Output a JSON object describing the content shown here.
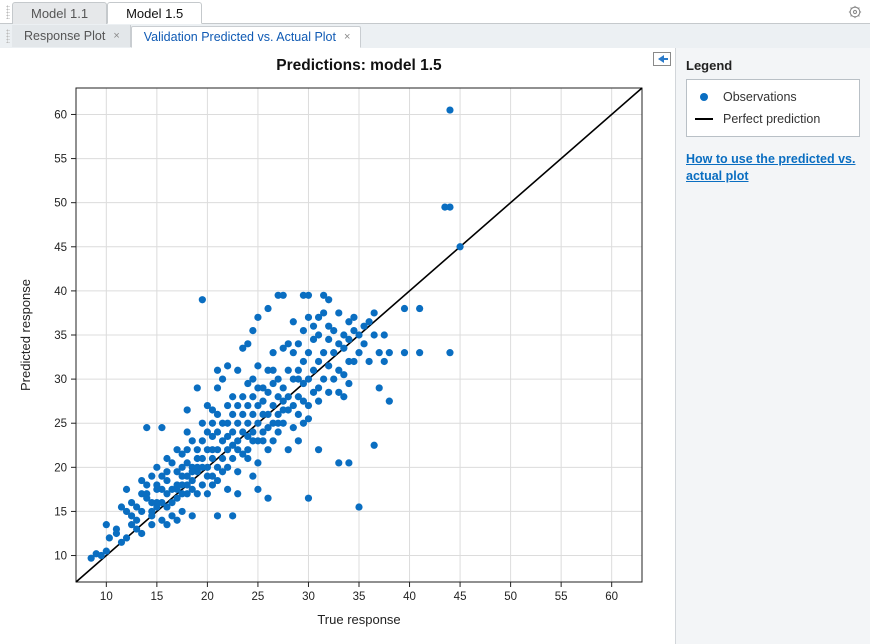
{
  "model_tabs": [
    {
      "label": "Model 1.1",
      "active": false
    },
    {
      "label": "Model 1.5",
      "active": true
    }
  ],
  "plot_tabs": [
    {
      "label": "Response Plot",
      "active": false
    },
    {
      "label": "Validation Predicted vs. Actual Plot",
      "active": true
    }
  ],
  "legend": {
    "title": "Legend",
    "items": [
      {
        "kind": "dot",
        "label": "Observations"
      },
      {
        "kind": "line",
        "label": "Perfect prediction"
      }
    ]
  },
  "help_link": "How to use the predicted vs. actual plot",
  "chart_data": {
    "type": "scatter",
    "title": "Predictions: model 1.5",
    "xlabel": "True response",
    "ylabel": "Predicted response",
    "xlim": [
      7,
      63
    ],
    "ylim": [
      7,
      63
    ],
    "xticks": [
      10,
      15,
      20,
      25,
      30,
      35,
      40,
      45,
      50,
      55,
      60
    ],
    "yticks": [
      10,
      15,
      20,
      25,
      30,
      35,
      40,
      45,
      50,
      55,
      60
    ],
    "perfect_line": {
      "x0": 7,
      "y0": 7,
      "x1": 63,
      "y1": 63
    },
    "series": [
      {
        "name": "Observations",
        "points": [
          [
            8.5,
            9.7
          ],
          [
            9.0,
            10.2
          ],
          [
            9.5,
            10.0
          ],
          [
            10.0,
            10.5
          ],
          [
            10.0,
            13.5
          ],
          [
            10.3,
            12.0
          ],
          [
            11.0,
            12.5
          ],
          [
            11.0,
            13.0
          ],
          [
            11.5,
            11.5
          ],
          [
            11.5,
            15.5
          ],
          [
            12.0,
            15.0
          ],
          [
            12.0,
            12.0
          ],
          [
            12.0,
            17.5
          ],
          [
            12.5,
            13.5
          ],
          [
            12.5,
            14.5
          ],
          [
            12.5,
            16.0
          ],
          [
            13.0,
            14.0
          ],
          [
            13.0,
            13.0
          ],
          [
            13.0,
            15.5
          ],
          [
            13.5,
            12.5
          ],
          [
            13.5,
            17.0
          ],
          [
            13.5,
            18.5
          ],
          [
            13.5,
            15.0
          ],
          [
            14.0,
            24.5
          ],
          [
            14.0,
            17.0
          ],
          [
            14.0,
            18.0
          ],
          [
            14.0,
            16.5
          ],
          [
            14.5,
            14.5
          ],
          [
            14.5,
            16.0
          ],
          [
            14.5,
            15.0
          ],
          [
            14.5,
            19.0
          ],
          [
            14.5,
            13.5
          ],
          [
            15.0,
            16.0
          ],
          [
            15.0,
            17.5
          ],
          [
            15.0,
            20.0
          ],
          [
            15.0,
            15.5
          ],
          [
            15.0,
            18.0
          ],
          [
            15.5,
            24.5
          ],
          [
            15.5,
            14.0
          ],
          [
            15.5,
            16.0
          ],
          [
            15.5,
            19.0
          ],
          [
            15.5,
            17.5
          ],
          [
            16.0,
            17.0
          ],
          [
            16.0,
            18.5
          ],
          [
            16.0,
            15.5
          ],
          [
            16.0,
            21.0
          ],
          [
            16.0,
            19.5
          ],
          [
            16.0,
            13.5
          ],
          [
            16.5,
            17.5
          ],
          [
            16.5,
            16.0
          ],
          [
            16.5,
            20.5
          ],
          [
            16.5,
            14.5
          ],
          [
            17.0,
            16.5
          ],
          [
            17.0,
            18.0
          ],
          [
            17.0,
            22.0
          ],
          [
            17.0,
            19.5
          ],
          [
            17.0,
            17.5
          ],
          [
            17.0,
            14.0
          ],
          [
            17.5,
            19.0
          ],
          [
            17.5,
            18.0
          ],
          [
            17.5,
            17.0
          ],
          [
            17.5,
            20.0
          ],
          [
            17.5,
            21.5
          ],
          [
            17.5,
            15.0
          ],
          [
            18.0,
            18.0
          ],
          [
            18.0,
            20.5
          ],
          [
            18.0,
            19.0
          ],
          [
            18.0,
            22.0
          ],
          [
            18.0,
            24.0
          ],
          [
            18.0,
            17.0
          ],
          [
            18.0,
            26.5
          ],
          [
            18.5,
            18.5
          ],
          [
            18.5,
            20.0
          ],
          [
            18.5,
            23.0
          ],
          [
            18.5,
            17.5
          ],
          [
            18.5,
            19.5
          ],
          [
            18.5,
            14.5
          ],
          [
            19.0,
            22.0
          ],
          [
            19.0,
            21.0
          ],
          [
            19.0,
            19.5
          ],
          [
            19.0,
            29.0
          ],
          [
            19.0,
            20.0
          ],
          [
            19.0,
            17.0
          ],
          [
            19.5,
            39.0
          ],
          [
            19.5,
            18.0
          ],
          [
            19.5,
            21.0
          ],
          [
            19.5,
            25.0
          ],
          [
            19.5,
            23.0
          ],
          [
            19.5,
            20.0
          ],
          [
            20.0,
            19.0
          ],
          [
            20.0,
            22.0
          ],
          [
            20.0,
            24.0
          ],
          [
            20.0,
            20.0
          ],
          [
            20.0,
            17.0
          ],
          [
            20.0,
            27.0
          ],
          [
            20.5,
            21.0
          ],
          [
            20.5,
            23.5
          ],
          [
            20.5,
            22.0
          ],
          [
            20.5,
            25.0
          ],
          [
            20.5,
            19.0
          ],
          [
            20.5,
            18.0
          ],
          [
            20.5,
            26.5
          ],
          [
            21.0,
            26.0
          ],
          [
            21.0,
            22.0
          ],
          [
            21.0,
            24.0
          ],
          [
            21.0,
            20.0
          ],
          [
            21.0,
            31.0
          ],
          [
            21.0,
            18.5
          ],
          [
            21.0,
            29.0
          ],
          [
            21.0,
            14.5
          ],
          [
            21.5,
            23.0
          ],
          [
            21.5,
            25.0
          ],
          [
            21.5,
            21.0
          ],
          [
            21.5,
            19.5
          ],
          [
            21.5,
            30.0
          ],
          [
            22.0,
            23.5
          ],
          [
            22.0,
            22.0
          ],
          [
            22.0,
            27.0
          ],
          [
            22.0,
            25.0
          ],
          [
            22.0,
            31.5
          ],
          [
            22.0,
            20.0
          ],
          [
            22.0,
            17.5
          ],
          [
            22.5,
            21.0
          ],
          [
            22.5,
            24.0
          ],
          [
            22.5,
            26.0
          ],
          [
            22.5,
            28.0
          ],
          [
            22.5,
            22.5
          ],
          [
            22.5,
            14.5
          ],
          [
            23.0,
            25.0
          ],
          [
            23.0,
            27.0
          ],
          [
            23.0,
            23.0
          ],
          [
            23.0,
            31.0
          ],
          [
            23.0,
            19.5
          ],
          [
            23.0,
            17.0
          ],
          [
            23.0,
            22.0
          ],
          [
            23.5,
            24.0
          ],
          [
            23.5,
            26.0
          ],
          [
            23.5,
            28.0
          ],
          [
            23.5,
            33.5
          ],
          [
            23.5,
            21.5
          ],
          [
            24.0,
            25.0
          ],
          [
            24.0,
            27.0
          ],
          [
            24.0,
            29.5
          ],
          [
            24.0,
            23.5
          ],
          [
            24.0,
            34.0
          ],
          [
            24.0,
            21.0
          ],
          [
            24.0,
            22.0
          ],
          [
            24.5,
            26.0
          ],
          [
            24.5,
            28.0
          ],
          [
            24.5,
            30.0
          ],
          [
            24.5,
            24.0
          ],
          [
            24.5,
            23.0
          ],
          [
            24.5,
            35.5
          ],
          [
            24.5,
            19.0
          ],
          [
            25.0,
            25.0
          ],
          [
            25.0,
            27.0
          ],
          [
            25.0,
            29.0
          ],
          [
            25.0,
            37.0
          ],
          [
            25.0,
            23.0
          ],
          [
            25.0,
            20.5
          ],
          [
            25.0,
            17.5
          ],
          [
            25.0,
            31.5
          ],
          [
            25.5,
            26.0
          ],
          [
            25.5,
            27.5
          ],
          [
            25.5,
            24.0
          ],
          [
            25.5,
            29.0
          ],
          [
            25.5,
            23.0
          ],
          [
            26.0,
            28.5
          ],
          [
            26.0,
            26.0
          ],
          [
            26.0,
            31.0
          ],
          [
            26.0,
            24.5
          ],
          [
            26.0,
            22.0
          ],
          [
            26.0,
            16.5
          ],
          [
            26.0,
            38.0
          ],
          [
            26.5,
            27.0
          ],
          [
            26.5,
            29.5
          ],
          [
            26.5,
            25.0
          ],
          [
            26.5,
            31.0
          ],
          [
            26.5,
            33.0
          ],
          [
            26.5,
            23.0
          ],
          [
            27.0,
            28.0
          ],
          [
            27.0,
            30.0
          ],
          [
            27.0,
            26.0
          ],
          [
            27.0,
            39.5
          ],
          [
            27.0,
            25.0
          ],
          [
            27.0,
            24.0
          ],
          [
            27.5,
            27.5
          ],
          [
            27.5,
            29.0
          ],
          [
            27.5,
            33.5
          ],
          [
            27.5,
            26.5
          ],
          [
            27.5,
            25.0
          ],
          [
            27.5,
            39.5
          ],
          [
            28.0,
            28.0
          ],
          [
            28.0,
            31.0
          ],
          [
            28.0,
            26.5
          ],
          [
            28.0,
            34.0
          ],
          [
            28.0,
            22.0
          ],
          [
            28.5,
            30.0
          ],
          [
            28.5,
            33.0
          ],
          [
            28.5,
            27.0
          ],
          [
            28.5,
            24.5
          ],
          [
            28.5,
            36.5
          ],
          [
            29.0,
            31.0
          ],
          [
            29.0,
            28.0
          ],
          [
            29.0,
            34.0
          ],
          [
            29.0,
            26.0
          ],
          [
            29.0,
            30.0
          ],
          [
            29.0,
            23.0
          ],
          [
            29.5,
            29.5
          ],
          [
            29.5,
            32.0
          ],
          [
            29.5,
            35.5
          ],
          [
            29.5,
            27.5
          ],
          [
            29.5,
            25.0
          ],
          [
            29.5,
            39.5
          ],
          [
            30.0,
            30.0
          ],
          [
            30.0,
            33.0
          ],
          [
            30.0,
            37.0
          ],
          [
            30.0,
            27.0
          ],
          [
            30.0,
            39.5
          ],
          [
            30.0,
            25.5
          ],
          [
            30.0,
            16.5
          ],
          [
            30.5,
            31.0
          ],
          [
            30.5,
            28.5
          ],
          [
            30.5,
            34.5
          ],
          [
            30.5,
            36.0
          ],
          [
            31.0,
            32.0
          ],
          [
            31.0,
            29.0
          ],
          [
            31.0,
            35.0
          ],
          [
            31.0,
            37.0
          ],
          [
            31.0,
            22.0
          ],
          [
            31.0,
            27.5
          ],
          [
            31.5,
            33.0
          ],
          [
            31.5,
            30.0
          ],
          [
            31.5,
            37.5
          ],
          [
            31.5,
            39.5
          ],
          [
            32.0,
            34.5
          ],
          [
            32.0,
            31.5
          ],
          [
            32.0,
            28.5
          ],
          [
            32.0,
            36.0
          ],
          [
            32.0,
            39.0
          ],
          [
            32.5,
            33.0
          ],
          [
            32.5,
            35.5
          ],
          [
            32.5,
            30.0
          ],
          [
            33.0,
            34.0
          ],
          [
            33.0,
            31.0
          ],
          [
            33.0,
            37.5
          ],
          [
            33.0,
            28.5
          ],
          [
            33.0,
            20.5
          ],
          [
            33.5,
            33.5
          ],
          [
            33.5,
            35.0
          ],
          [
            33.5,
            30.5
          ],
          [
            33.5,
            28.0
          ],
          [
            34.0,
            34.5
          ],
          [
            34.0,
            29.5
          ],
          [
            34.0,
            36.5
          ],
          [
            34.0,
            20.5
          ],
          [
            34.0,
            32.0
          ],
          [
            34.5,
            35.5
          ],
          [
            34.5,
            32.0
          ],
          [
            34.5,
            37.0
          ],
          [
            35.0,
            33.0
          ],
          [
            35.0,
            35.0
          ],
          [
            35.0,
            15.5
          ],
          [
            35.5,
            34.0
          ],
          [
            35.5,
            36.0
          ],
          [
            36.0,
            36.5
          ],
          [
            36.0,
            32.0
          ],
          [
            36.5,
            35.0
          ],
          [
            36.5,
            22.5
          ],
          [
            36.5,
            37.5
          ],
          [
            37.0,
            29.0
          ],
          [
            37.0,
            33.0
          ],
          [
            37.5,
            35.0
          ],
          [
            37.5,
            32.0
          ],
          [
            38.0,
            27.5
          ],
          [
            38.0,
            33.0
          ],
          [
            39.5,
            33.0
          ],
          [
            39.5,
            38.0
          ],
          [
            41.0,
            38.0
          ],
          [
            41.0,
            33.0
          ],
          [
            43.5,
            49.5
          ],
          [
            44.0,
            33.0
          ],
          [
            44.0,
            49.5
          ],
          [
            44.0,
            60.5
          ],
          [
            45.0,
            45.0
          ]
        ]
      }
    ]
  }
}
